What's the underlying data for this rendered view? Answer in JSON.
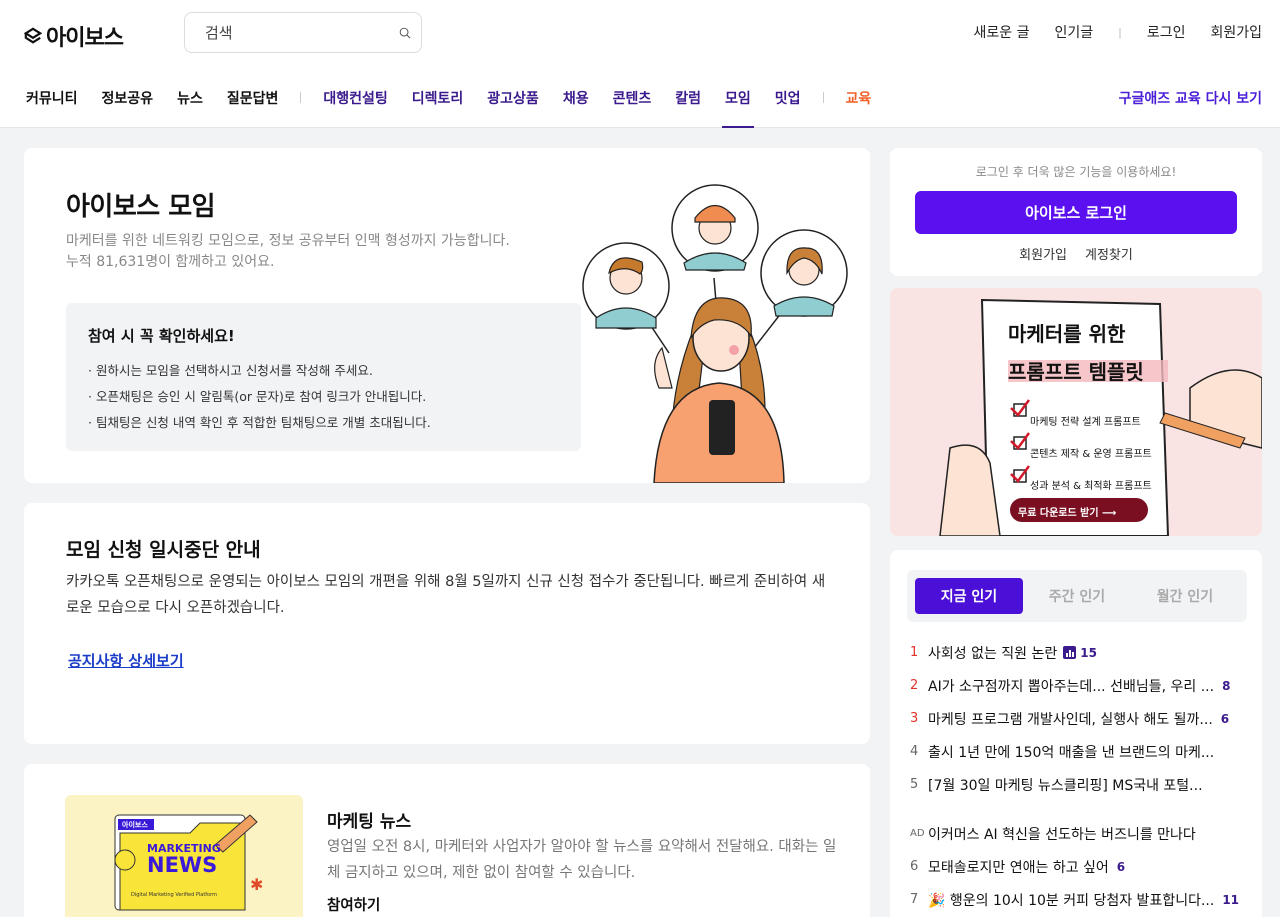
{
  "header": {
    "logo": "아이보스",
    "search_placeholder": "검색",
    "util": [
      "새로운 글",
      "인기글",
      "로그인",
      "회원가입"
    ],
    "nav_left": [
      "커뮤니티",
      "정보공유",
      "뉴스",
      "질문답변"
    ],
    "nav_mid": [
      "대행컨설팅",
      "디렉토리",
      "광고상품",
      "채용",
      "콘텐츠",
      "칼럼",
      "모임",
      "밋업"
    ],
    "nav_edu": "교육",
    "nav_right": "구글애즈 교육 다시 보기"
  },
  "hero": {
    "title": "아이보스 모임",
    "desc1": "마케터를 위한 네트워킹 모임으로, 정보 공유부터 인맥 형성까지 가능합니다.",
    "desc2": "누적 81,631명이 함께하고 있어요.",
    "notice_title": "참여 시 꼭 확인하세요!",
    "notice_items": [
      "· 원하시는 모임을 선택하시고 신청서를 작성해 주세요.",
      "· 오픈채팅은 승인 시 알림톡(or 문자)로 참여 링크가 안내됩니다.",
      "· 팀채팅은 신청 내역 확인 후 적합한 팀채팅으로 개별 초대됩니다."
    ]
  },
  "pause": {
    "title": "모임 신청 일시중단 안내",
    "body": "카카오톡 오픈채팅으로 운영되는 아이보스 모임의 개편을 위해 8월 5일까지 신규 신청 접수가 중단됩니다. 빠르게 준비하여 새로운 모습으로 다시 오픈하겠습니다.",
    "link": "공지사항 상세보기"
  },
  "news": {
    "thumb_tag": "아이보스",
    "thumb_line1": "MARKETING",
    "thumb_line2": "NEWS",
    "thumb_sub": "Digital Marketing Verified Platform",
    "title": "마케팅 뉴스",
    "body": "영업일 오전 8시, 마케터와 사업자가 알아야 할 뉴스를 요약해서 전달해요. 대화는 일체 금지하고 있으며, 제한 없이 참여할 수 있습니다.",
    "join": "참여하기"
  },
  "login": {
    "hint": "로그인 후 더욱 많은 기능을 이용하세요!",
    "button": "아이보스 로그인",
    "signup": "회원가입",
    "find": "계정찾기"
  },
  "banner": {
    "line1": "마케터를 위한",
    "line2": "프롬프트 템플릿",
    "items": [
      "마케팅 전략 설계 프롬프트",
      "콘텐츠 제작 & 운영 프롬프트",
      "성과 분석 & 최적화 프롬프트"
    ],
    "cta": "무료 다운로드 받기 ⟶"
  },
  "popular": {
    "tabs": [
      "지금 인기",
      "주간 인기",
      "월간 인기"
    ],
    "items": [
      {
        "num": "1",
        "title": "사회성 없는 직원 논란",
        "count": "15",
        "chart": true
      },
      {
        "num": "2",
        "title": "AI가 소구점까지 뽑아주는데... 선배님들, 우리 ...",
        "count": "8"
      },
      {
        "num": "3",
        "title": "마케팅 프로그램 개발사인데, 실행사 해도 될까...",
        "count": "6"
      },
      {
        "num": "4",
        "title": "출시 1년 만에 150억 매출을 낸 브랜드의 마케...",
        "count": ""
      },
      {
        "num": "5",
        "title": "[7월 30일 마케팅 뉴스클리핑] MS국내 포털...",
        "count": ""
      }
    ],
    "ad": {
      "num": "AD",
      "title": "이커머스 AI 혁신을 선도하는 버즈니를 만나다"
    },
    "items2": [
      {
        "num": "6",
        "title": "모태솔로지만 연애는 하고 싶어",
        "count": "6"
      },
      {
        "num": "7",
        "title": "🎉 행운의 10시 10분 커피 당첨자 발표합니다...",
        "count": "11"
      }
    ]
  }
}
